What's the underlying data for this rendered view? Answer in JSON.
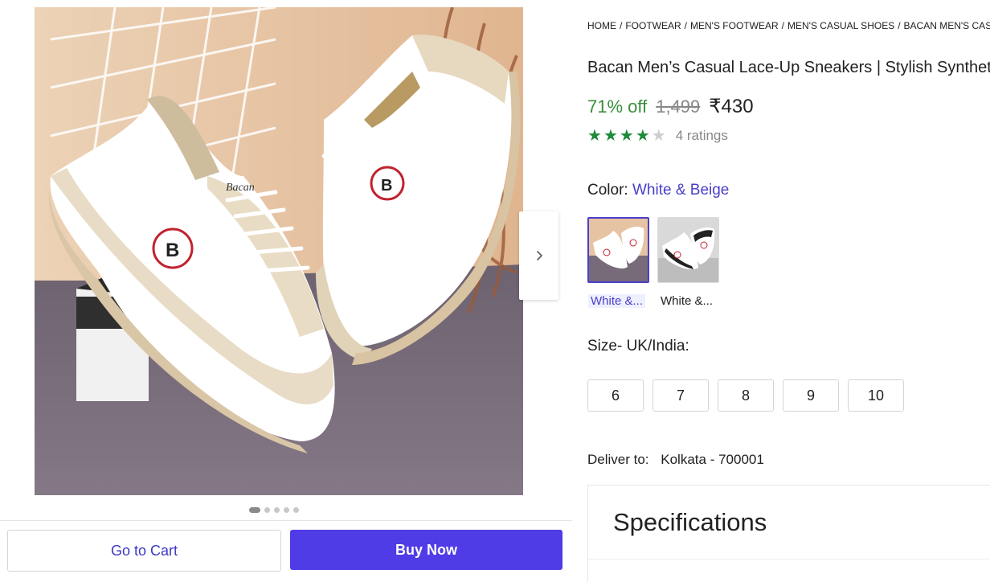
{
  "breadcrumb": [
    {
      "label": "HOME"
    },
    {
      "label": "FOOTWEAR"
    },
    {
      "label": "MEN'S FOOTWEAR"
    },
    {
      "label": "MEN'S CASUAL SHOES"
    },
    {
      "label": "BACAN MEN'S CASUAL"
    }
  ],
  "product": {
    "title": "Bacan Men’s Casual Lace-Up Sneakers | Stylish Synthetic",
    "discount": "71% off",
    "mrp": "1,499",
    "price": "₹430",
    "rating_stars": 4,
    "rating_text": "4 ratings",
    "brand_logo": "Bacan"
  },
  "color": {
    "label": "Color:",
    "selected": "White & Beige",
    "options": [
      {
        "label": "White &...",
        "selected": true
      },
      {
        "label": "White &...",
        "selected": false
      }
    ]
  },
  "size": {
    "label": "Size- UK/India:",
    "options": [
      "6",
      "7",
      "8",
      "9",
      "10"
    ]
  },
  "delivery": {
    "label": "Deliver to:",
    "location": "Kolkata - 700001"
  },
  "specifications": {
    "title": "Specifications"
  },
  "gallery": {
    "image_count": 5,
    "active_index": 0
  },
  "actions": {
    "cart_label": "Go to Cart",
    "buy_label": "Buy Now"
  },
  "icons": {
    "next": "chevron-right-icon",
    "star_filled": "star-icon",
    "star_empty": "star-empty-icon"
  },
  "colors": {
    "accent": "#4f3ce6",
    "link": "#4a3fc9",
    "discount": "#388e3c",
    "star": "#1f8a3a"
  }
}
